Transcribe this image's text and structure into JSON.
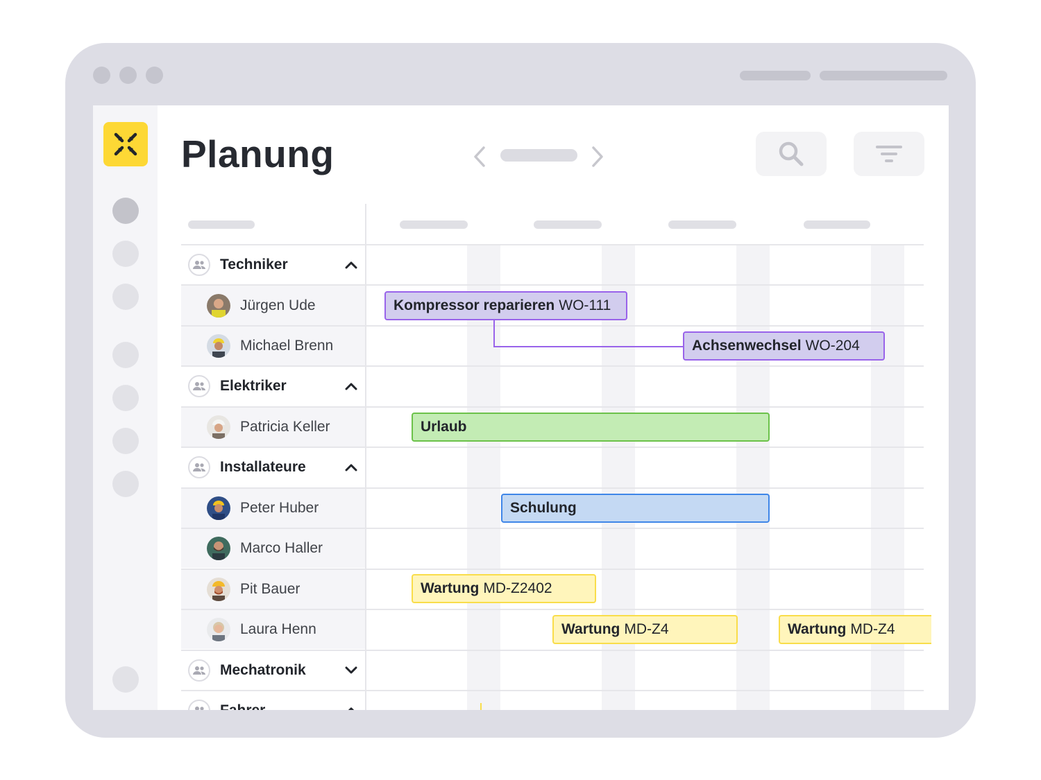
{
  "app": {
    "title": "Planung"
  },
  "icons": {
    "logo": "crossed-arrows-icon",
    "search": "search-icon",
    "filter": "filter-icon",
    "group": "people-icon",
    "collapse": "chevron-up-icon",
    "expand": "chevron-down-icon"
  },
  "colors": {
    "logo_bg": "#fdd835",
    "purple": "#9963ea",
    "green": "#6cc24a",
    "blue": "#3f86e8",
    "yellow": "#f9dd4a"
  },
  "groups": {
    "techniker": {
      "name": "Techniker"
    },
    "elektriker": {
      "name": "Elektriker"
    },
    "installateure": {
      "name": "Installateure"
    },
    "mechatronik": {
      "name": "Mechatronik"
    },
    "fahrer": {
      "name": "Fahrer"
    }
  },
  "people": {
    "juergen": {
      "name": "Jürgen Ude"
    },
    "michael": {
      "name": "Michael Brenn"
    },
    "patricia": {
      "name": "Patricia Keller"
    },
    "peter": {
      "name": "Peter Huber"
    },
    "marco": {
      "name": "Marco Haller"
    },
    "pit": {
      "name": "Pit Bauer"
    },
    "laura": {
      "name": "Laura Henn"
    }
  },
  "tasks": {
    "kompressor": {
      "title": "Kompressor reparieren",
      "code": "WO-111"
    },
    "achsenwechsel": {
      "title": "Achsenwechsel",
      "code": "WO-204"
    },
    "urlaub": {
      "title": "Urlaub"
    },
    "schulung": {
      "title": "Schulung"
    },
    "wartung1": {
      "title": "Wartung",
      "code": "MD-Z2402"
    },
    "wartung2": {
      "title": "Wartung",
      "code": "MD-Z4"
    },
    "wartung3": {
      "title": "Wartung",
      "code": "MD-Z4"
    }
  }
}
